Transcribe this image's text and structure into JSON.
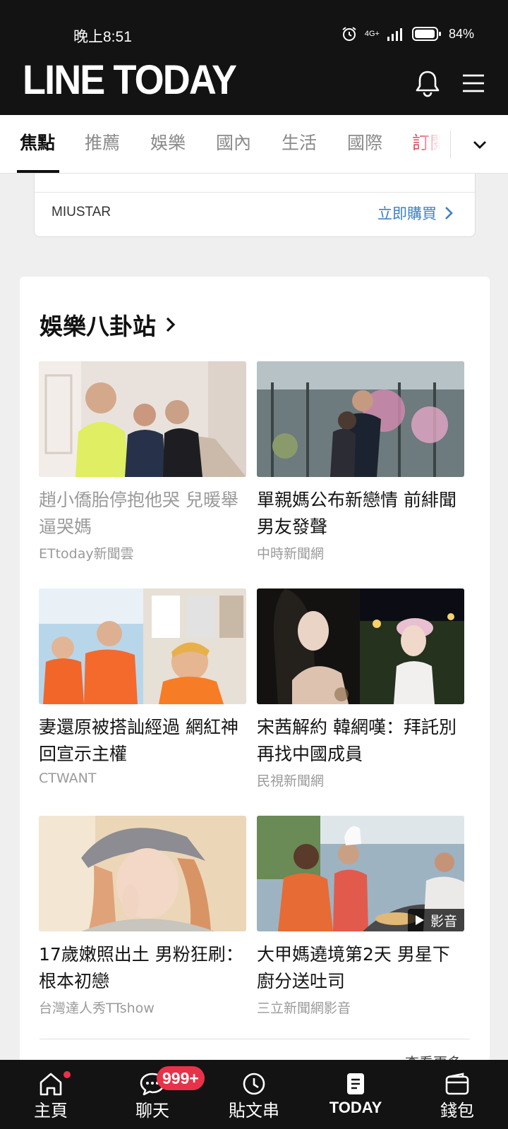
{
  "status_bar": {
    "time": "晚上8:51",
    "network": "4G+",
    "battery": "84%"
  },
  "header": {
    "logo": "LINE TODAY"
  },
  "tabs": [
    {
      "label": "焦點",
      "active": true
    },
    {
      "label": "推薦"
    },
    {
      "label": "娛樂"
    },
    {
      "label": "國內"
    },
    {
      "label": "生活"
    },
    {
      "label": "國際"
    },
    {
      "label": "訂閱"
    }
  ],
  "ad": {
    "brand": "MIUSTAR",
    "cta": "立即購買"
  },
  "section": {
    "title": "娛樂八卦站",
    "more": "查看更多",
    "articles": [
      {
        "headline": "趙小僑胎停抱他哭 兒暖舉逼哭媽",
        "source": "ETtoday新聞雲",
        "read": true
      },
      {
        "headline": "單親媽公布新戀情 前緋聞男友發聲",
        "source": "中時新聞網"
      },
      {
        "headline": "妻還原被搭訕經過 網紅神回宣示主權",
        "source": "CTWANT"
      },
      {
        "headline": "宋茜解約 韓網嘆：拜託別再找中國成員",
        "source": "民視新聞網"
      },
      {
        "headline": "17歲嫩照出土 男粉狂刷：根本初戀",
        "source": "台灣達人秀TTshow"
      },
      {
        "headline": "大甲媽遶境第2天 男星下廚分送吐司",
        "source": "三立新聞網影音",
        "video_label": "影音"
      }
    ]
  },
  "bottom_nav": {
    "items": [
      {
        "label": "主頁"
      },
      {
        "label": "聊天",
        "badge": "999+"
      },
      {
        "label": "貼文串"
      },
      {
        "label": "TODAY"
      },
      {
        "label": "錢包"
      }
    ]
  }
}
